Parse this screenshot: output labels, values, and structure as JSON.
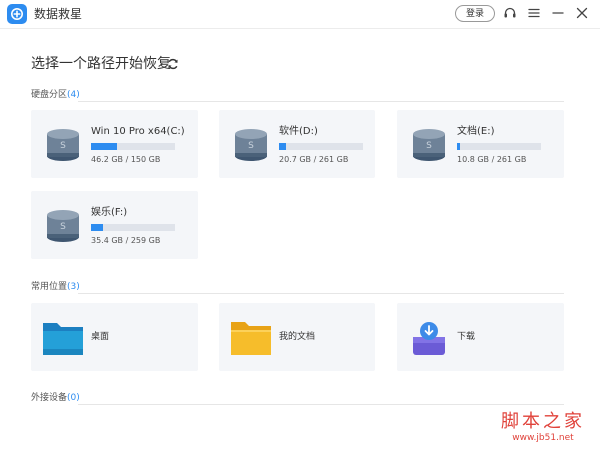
{
  "app": {
    "title": "数据救星",
    "login_label": "登录"
  },
  "header": {
    "title": "选择一个路径开始恢复"
  },
  "sections": {
    "disks": {
      "label": "硬盘分区",
      "count": "(4)"
    },
    "common": {
      "label": "常用位置",
      "count": "(3)"
    },
    "external": {
      "label": "外接设备",
      "count": "(0)"
    }
  },
  "drives": [
    {
      "name": "Win 10 Pro x64(C:)",
      "size": "46.2 GB / 150 GB",
      "usage": 0.31
    },
    {
      "name": "软件(D:)",
      "size": "20.7 GB / 261 GB",
      "usage": 0.08
    },
    {
      "name": "文档(E:)",
      "size": "10.8 GB / 261 GB",
      "usage": 0.04
    },
    {
      "name": "娱乐(F:)",
      "size": "35.4 GB / 259 GB",
      "usage": 0.14
    }
  ],
  "locations": [
    {
      "name": "桌面"
    },
    {
      "name": "我的文档"
    },
    {
      "name": "下载"
    }
  ],
  "watermark": {
    "main": "脚本之家",
    "sub": "www.jb51.net"
  },
  "colors": {
    "accent": "#2d8cf0",
    "card_bg": "#f4f6f9",
    "watermark": "#e0423a"
  }
}
